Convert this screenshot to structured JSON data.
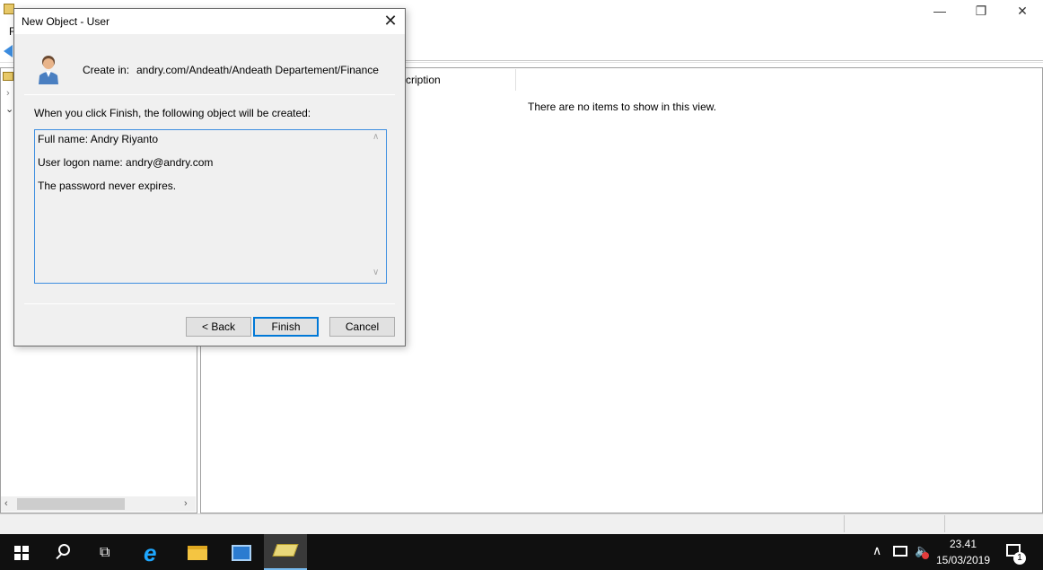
{
  "main_window": {
    "menu_first_letter": "F",
    "column_header": "cription",
    "empty_message": "There are no items to show in this view.",
    "controls": {
      "minimize": "—",
      "maximize": "❐",
      "close": "✕"
    }
  },
  "dialog": {
    "title": "New Object - User",
    "close_glyph": "✕",
    "create_in_label": "Create in:",
    "create_in_path": "andry.com/Andeath/Andeath Departement/Finance",
    "intro": "When you click Finish, the following object will be created:",
    "summary_lines": [
      "Full name: Andry Riyanto",
      "User logon name: andry@andry.com",
      "The password never expires."
    ],
    "buttons": {
      "back": "< Back",
      "finish": "Finish",
      "cancel": "Cancel"
    }
  },
  "taskbar": {
    "icons": [
      "start-icon",
      "search-icon",
      "task-view-icon",
      "internet-explorer-icon",
      "file-explorer-icon",
      "server-manager-icon",
      "active-directory-icon"
    ],
    "clock_time": "23.41",
    "clock_date": "15/03/2019",
    "notification_count": "1"
  },
  "colors": {
    "taskbar_bg": "#101010",
    "accent": "#0078d7",
    "dialog_bg": "#f0f0f0"
  }
}
